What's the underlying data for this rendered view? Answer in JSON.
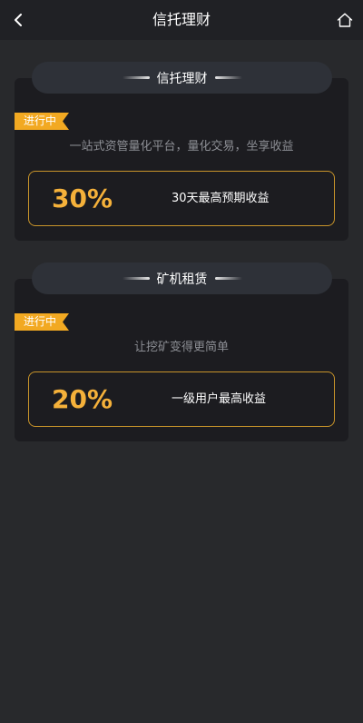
{
  "header": {
    "title": "信托理财",
    "back_icon": "chevron-left-icon",
    "home_icon": "home-icon"
  },
  "sections": [
    {
      "title": "信托理财",
      "status": "进行中",
      "subtitle": "一站式资管量化平台，量化交易，坐享收益",
      "stat_value": "30%",
      "stat_label": "30天最高预期收益"
    },
    {
      "title": "矿机租赁",
      "status": "进行中",
      "subtitle": "让挖矿变得更简单",
      "stat_value": "20%",
      "stat_label": "一级用户最高收益"
    }
  ],
  "colors": {
    "background": "#28292c",
    "header": "#202125",
    "card": "#1c1c20",
    "accent": "#f5b13a",
    "tag": "#f2a922"
  }
}
